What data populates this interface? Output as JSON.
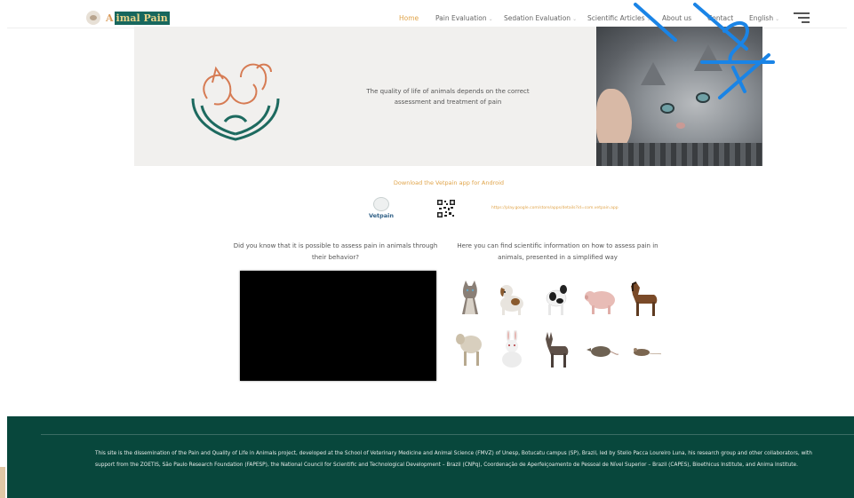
{
  "header": {
    "logo_prefix": "A",
    "logo_text": "imal Pain",
    "nav": [
      {
        "label": "Home",
        "dropdown": false,
        "active": true
      },
      {
        "label": "Pain Evaluation",
        "dropdown": true
      },
      {
        "label": "Sedation Evaluation",
        "dropdown": true
      },
      {
        "label": "Scientific Articles",
        "dropdown": true
      },
      {
        "label": "About us",
        "dropdown": false
      },
      {
        "label": "Contact",
        "dropdown": false
      },
      {
        "label": "English",
        "dropdown": true
      }
    ],
    "dropdown_glyph": "⌄"
  },
  "hero": {
    "tagline": "The quality of life of animals depends on the correct assessment and treatment of pain"
  },
  "download": {
    "title": "Download the Vetpain app for Android",
    "app_name": "Vetpain",
    "url": "https://play.google.com/store/apps/details?id=com.vetpain.app"
  },
  "intro": {
    "left_question": "Did you know that it is possible to assess pain in animals through their behavior?",
    "right_text": "Here you can find scientific information on how to assess pain in animals, presented in a simplified way"
  },
  "animals": [
    "cat-icon",
    "dog-icon",
    "cow-icon",
    "pig-icon",
    "horse-icon",
    "sheep-icon",
    "rabbit-icon",
    "donkey-icon",
    "rat-icon",
    "mouse-icon"
  ],
  "footer": {
    "text": "This site is the dissemination of the Pain and Quality of Life in Animals project, developed at the School of Veterinary Medicine and Animal Science (FMVZ) of Unesp, Botucatu campus (SP), Brazil, led by Stelio Pacca Loureiro Luna, his research group and other collaborators, with support from the ZOETIS, São Paulo Research Foundation (FAPESP), the National Council for Scientific and Technological Development – Brazil (CNPq), Coordenação de Aperfeiçoamento de Pessoal de Nível Superior – Brazil (CAPES), Bioethicus Institute, and Anima Institute."
  },
  "colors": {
    "accent": "#e0a44a",
    "footer_bg": "#08473c",
    "brand_teal": "#17675d",
    "overlay_blue": "#1a84e6"
  }
}
